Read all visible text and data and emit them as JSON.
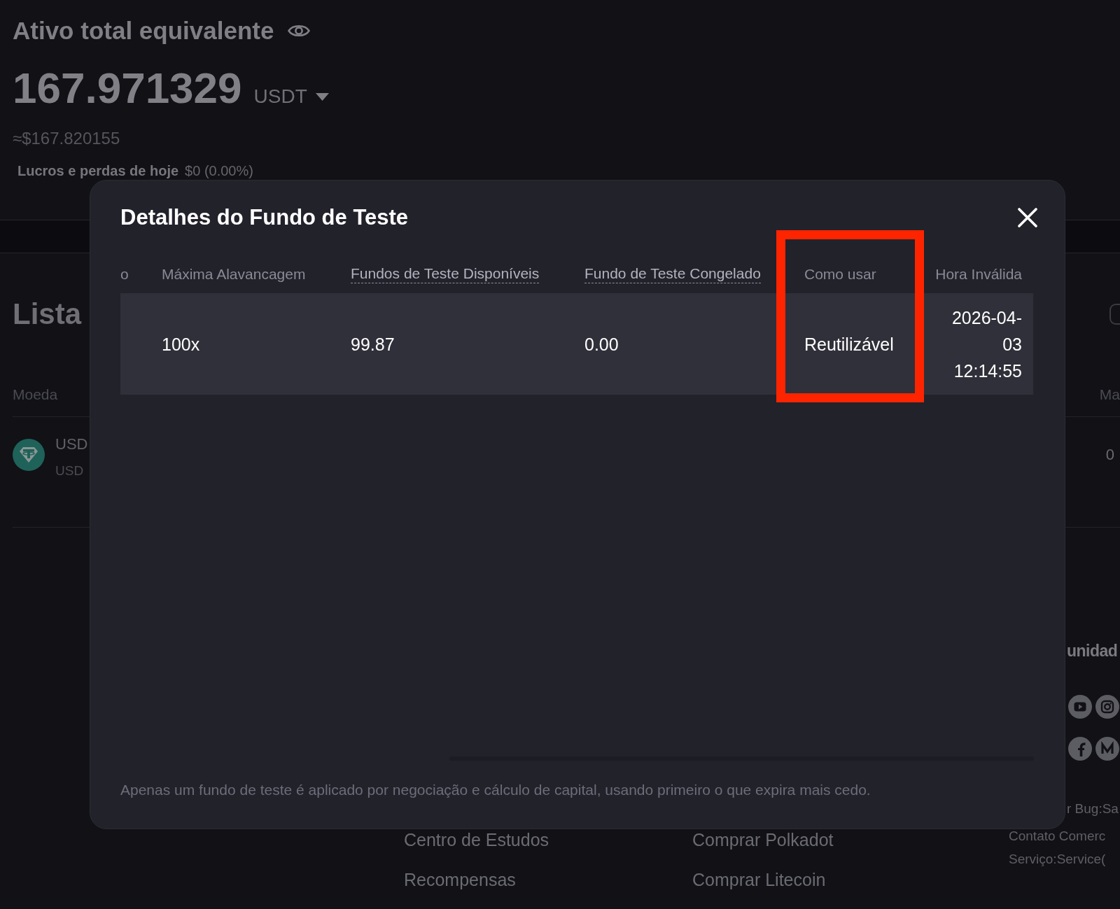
{
  "summary": {
    "title": "Ativo total equivalente",
    "amount": "167.971329",
    "currency": "USDT",
    "fiat_estimate": "≈$167.820155",
    "pnl_label": "Lucros e perdas de hoje",
    "pnl_value": "$0 (0.00%)"
  },
  "list": {
    "title": "Lista",
    "columns": [
      "Moeda",
      "Ma"
    ],
    "rows": [
      {
        "name": "USD",
        "code": "USD",
        "value": "0"
      }
    ]
  },
  "community": {
    "title": "unidad"
  },
  "footer": {
    "link_columns": [
      [
        "Centro de Estudos",
        "Recompensas"
      ],
      [
        "Comprar Polkadot",
        "Comprar Litecoin"
      ]
    ],
    "contact_lines": [
      "r Bug:Sa",
      "Contato Comerc",
      "Serviço:Service("
    ]
  },
  "modal": {
    "title": "Detalhes do Fundo de Teste",
    "table": {
      "columns": [
        {
          "label": "o",
          "underlined": false,
          "highlighted": false
        },
        {
          "label": "Máxima Alavancagem",
          "underlined": false,
          "highlighted": false
        },
        {
          "label": "Fundos de Teste Disponíveis",
          "underlined": true,
          "highlighted": false
        },
        {
          "label": "Fundo de Teste Congelado",
          "underlined": true,
          "highlighted": false
        },
        {
          "label": "Como usar",
          "underlined": false,
          "highlighted": true
        },
        {
          "label": "Hora Inválida",
          "underlined": false,
          "highlighted": false
        }
      ],
      "rows": [
        {
          "cells": [
            "",
            "100x",
            "99.87",
            "0.00",
            "Reutilizável",
            "2026-04-03 12:14:55"
          ]
        }
      ]
    },
    "note": "Apenas um fundo de teste é aplicado por negociação e cálculo de capital, usando primeiro o que expira mais cedo."
  }
}
